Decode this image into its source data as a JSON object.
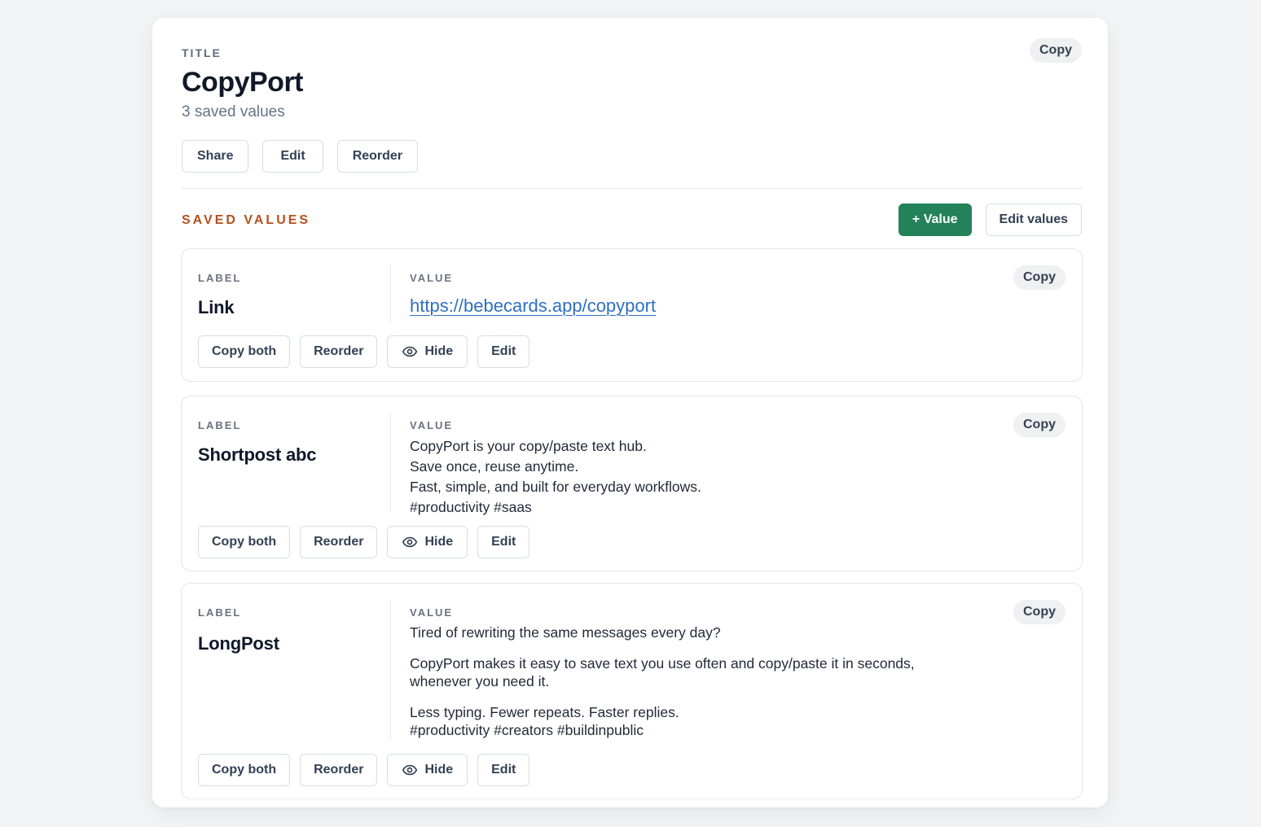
{
  "header": {
    "kicker": "TITLE",
    "title": "CopyPort",
    "subtitle": "3 saved values",
    "copy_label": "Copy",
    "actions": {
      "share": "Share",
      "edit": "Edit",
      "reorder": "Reorder"
    }
  },
  "section": {
    "title": "SAVED VALUES",
    "add_value": "+ Value",
    "edit_values": "Edit values"
  },
  "item_common": {
    "label_kicker": "LABEL",
    "value_kicker": "VALUE",
    "copy": "Copy",
    "copy_both": "Copy both",
    "reorder": "Reorder",
    "hide": "Hide",
    "edit": "Edit"
  },
  "items": [
    {
      "label": "Link",
      "link": "https://bebecards.app/copyport"
    },
    {
      "label": "Shortpost abc",
      "lines": [
        "CopyPort is your copy/paste text hub.",
        "Save once, reuse anytime.",
        "Fast, simple, and built for everyday workflows.",
        "#productivity #saas"
      ]
    },
    {
      "label": "LongPost",
      "lines": [
        "Tired of rewriting the same messages every day?",
        "CopyPort makes it easy to save text you use often and copy/paste it in seconds,",
        "whenever you need it.",
        "Less typing. Fewer repeats. Faster replies.",
        "#productivity #creators #buildinpublic"
      ]
    }
  ]
}
